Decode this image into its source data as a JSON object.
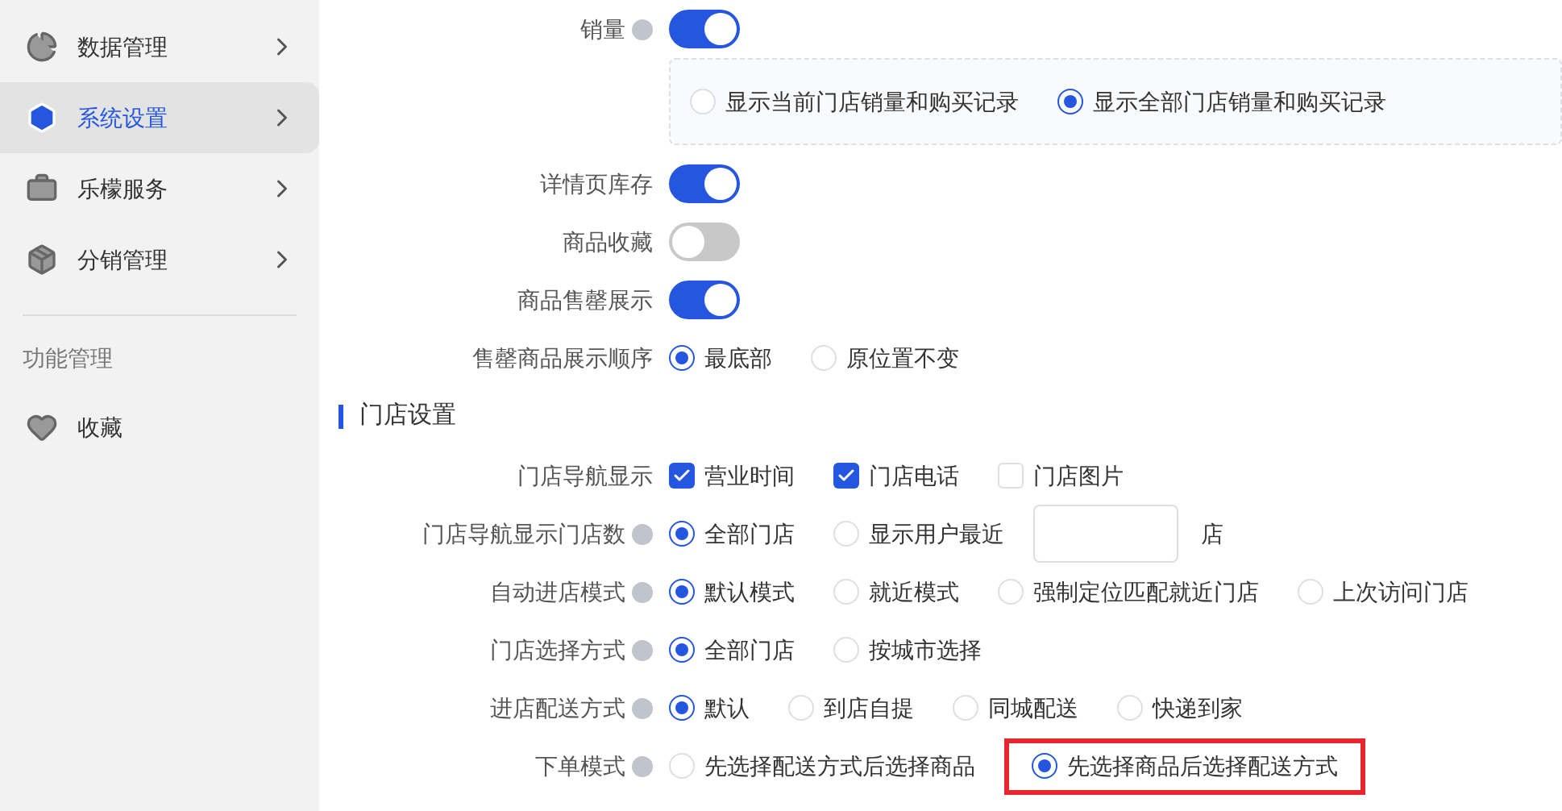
{
  "sidebar": {
    "items": [
      {
        "label": "数据管理",
        "selected": false
      },
      {
        "label": "系统设置",
        "selected": true
      },
      {
        "label": "乐檬服务",
        "selected": false
      },
      {
        "label": "分销管理",
        "selected": false
      }
    ],
    "section_title": "功能管理",
    "favorites": [
      {
        "label": "收藏"
      }
    ]
  },
  "form": {
    "rows": [
      {
        "kind": "switch",
        "label": "销量",
        "help": true,
        "on": true,
        "sub_options": [
          {
            "label": "显示当前门店销量和购买记录",
            "selected": false
          },
          {
            "label": "显示全部门店销量和购买记录",
            "selected": true
          }
        ]
      },
      {
        "kind": "switch",
        "label": "详情页库存",
        "help": false,
        "on": true
      },
      {
        "kind": "switch",
        "label": "商品收藏",
        "help": false,
        "on": false
      },
      {
        "kind": "switch",
        "label": "商品售罄展示",
        "help": false,
        "on": true
      },
      {
        "kind": "radio",
        "label": "售罄商品展示顺序",
        "help": false,
        "options": [
          {
            "kind": "radio",
            "label": "最底部",
            "selected": true
          },
          {
            "kind": "radio",
            "label": "原位置不变",
            "selected": false
          }
        ]
      },
      {
        "kind": "section",
        "label": "门店设置"
      },
      {
        "kind": "checkbox",
        "label": "门店导航显示",
        "help": false,
        "options": [
          {
            "kind": "checkbox",
            "label": "营业时间",
            "checked": true
          },
          {
            "kind": "checkbox",
            "label": "门店电话",
            "checked": true
          },
          {
            "kind": "checkbox",
            "label": "门店图片",
            "checked": false
          }
        ]
      },
      {
        "kind": "radio",
        "label": "门店导航显示门店数",
        "help": true,
        "options": [
          {
            "kind": "radio",
            "label": "全部门店",
            "selected": true
          },
          {
            "kind": "radio",
            "label": "显示用户最近",
            "selected": false
          },
          {
            "kind": "input"
          },
          {
            "kind": "text",
            "label": "店"
          }
        ]
      },
      {
        "kind": "radio",
        "label": "自动进店模式",
        "help": true,
        "options": [
          {
            "kind": "radio",
            "label": "默认模式",
            "selected": true
          },
          {
            "kind": "radio",
            "label": "就近模式",
            "selected": false
          },
          {
            "kind": "radio",
            "label": "强制定位匹配就近门店",
            "selected": false
          },
          {
            "kind": "radio",
            "label": "上次访问门店",
            "selected": false
          }
        ]
      },
      {
        "kind": "radio",
        "label": "门店选择方式",
        "help": true,
        "options": [
          {
            "kind": "radio",
            "label": "全部门店",
            "selected": true
          },
          {
            "kind": "radio",
            "label": "按城市选择",
            "selected": false
          }
        ]
      },
      {
        "kind": "radio",
        "label": "进店配送方式",
        "help": true,
        "options": [
          {
            "kind": "radio",
            "label": "默认",
            "selected": true
          },
          {
            "kind": "radio",
            "label": "到店自提",
            "selected": false
          },
          {
            "kind": "radio",
            "label": "同城配送",
            "selected": false
          },
          {
            "kind": "radio",
            "label": "快递到家",
            "selected": false
          }
        ]
      },
      {
        "kind": "radio",
        "label": "下单模式",
        "help": true,
        "options": [
          {
            "kind": "radio",
            "label": "先选择配送方式后选择商品",
            "selected": false
          },
          {
            "kind": "radio",
            "label": "先选择商品后选择配送方式",
            "selected": true,
            "highlighted": true
          }
        ]
      }
    ]
  }
}
